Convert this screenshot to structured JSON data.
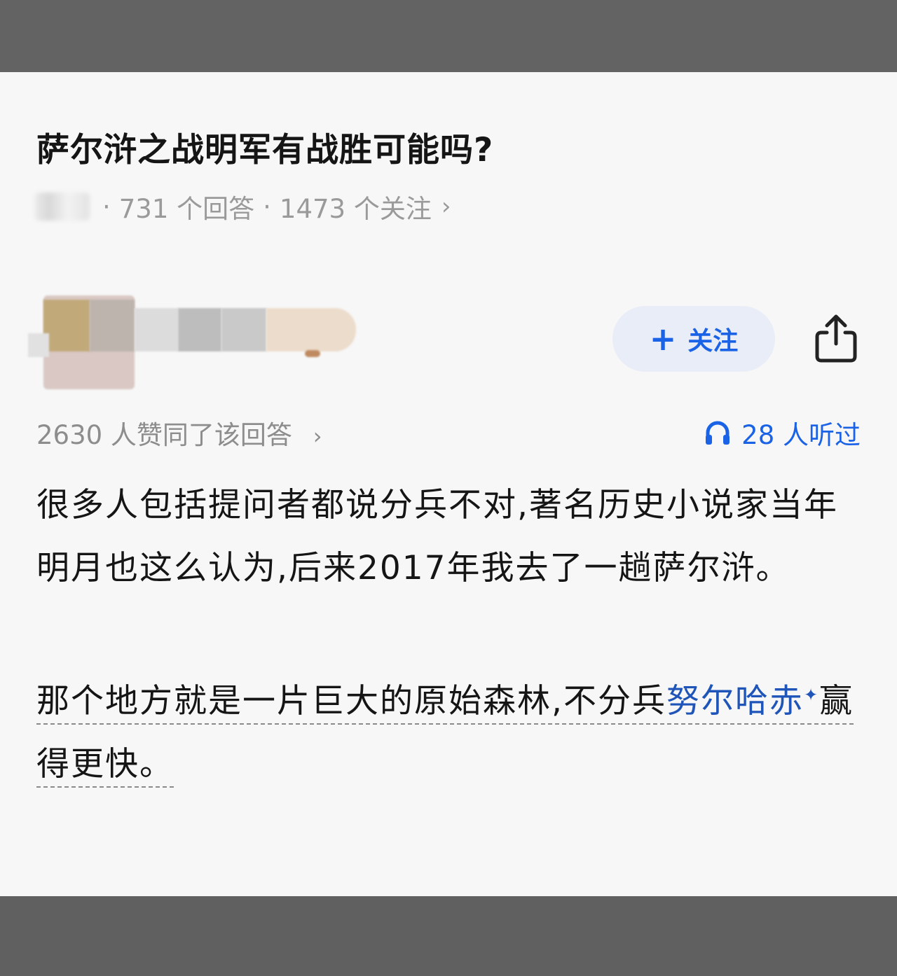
{
  "question": {
    "title": "萨尔浒之战明军有战胜可能吗?",
    "answers_count": "731 个回答",
    "followers_count": "1473 个关注",
    "chevron": "›"
  },
  "author": {
    "follow_plus": "+",
    "follow_label": "关注"
  },
  "answer_meta": {
    "upvotes": "2630 人赞同了该回答",
    "upvote_chevron": "›",
    "listen_count": "28 人听过"
  },
  "answer_body": {
    "para1": "很多人包括提问者都说分兵不对,著名历史小说家当年明月也这么认为,后来2017年我去了一趟萨尔浒。",
    "para2_before": "那个地方就是一片巨大的原始森林,不分兵",
    "para2_link": "努尔哈赤",
    "para2_star": "✦",
    "para2_after": "赢得更快。"
  },
  "icons": {
    "share": "share-icon",
    "headphones": "headphones-icon"
  },
  "colors": {
    "accent": "#1a62e6",
    "link": "#1f55b8",
    "follow_bg": "#e8edf7",
    "text": "#151515",
    "muted": "#8d8d8d",
    "card_bg": "#f7f7f7"
  }
}
